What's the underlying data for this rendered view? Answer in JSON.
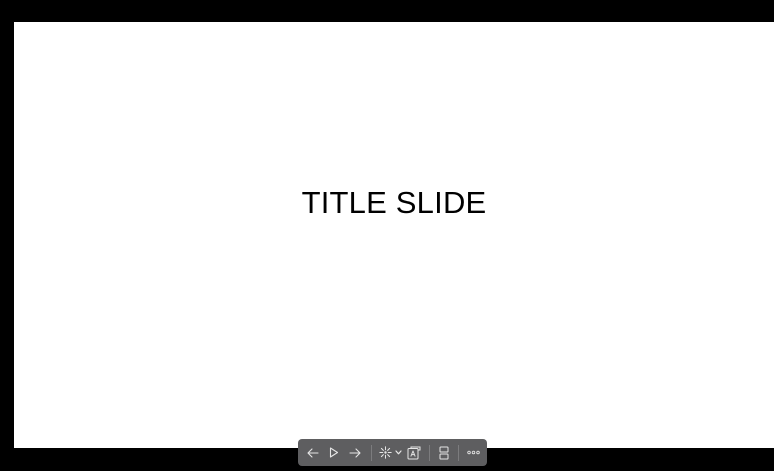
{
  "slide": {
    "title": "TITLE SLIDE"
  },
  "toolbar": {
    "background_color": "#5e5e60",
    "icon_color": "#e6e6e6",
    "buttons": [
      {
        "name": "previous-slide-button",
        "icon": "arrow-left-icon"
      },
      {
        "name": "play-button",
        "icon": "play-triangle-icon"
      },
      {
        "name": "next-slide-button",
        "icon": "arrow-right-icon"
      },
      {
        "name": "laser-pointer-button",
        "icon": "laser-pointer-icon"
      },
      {
        "name": "pointer-options-dropdown",
        "icon": "chevron-down-icon"
      },
      {
        "name": "subtitles-button",
        "icon": "subtitle-icon"
      },
      {
        "name": "slide-sorter-button",
        "icon": "slides-grid-icon"
      },
      {
        "name": "more-options-button",
        "icon": "more-dots-icon"
      }
    ]
  },
  "colors": {
    "frame": "#000000",
    "slide_background": "#ffffff",
    "title_text": "#000000"
  }
}
